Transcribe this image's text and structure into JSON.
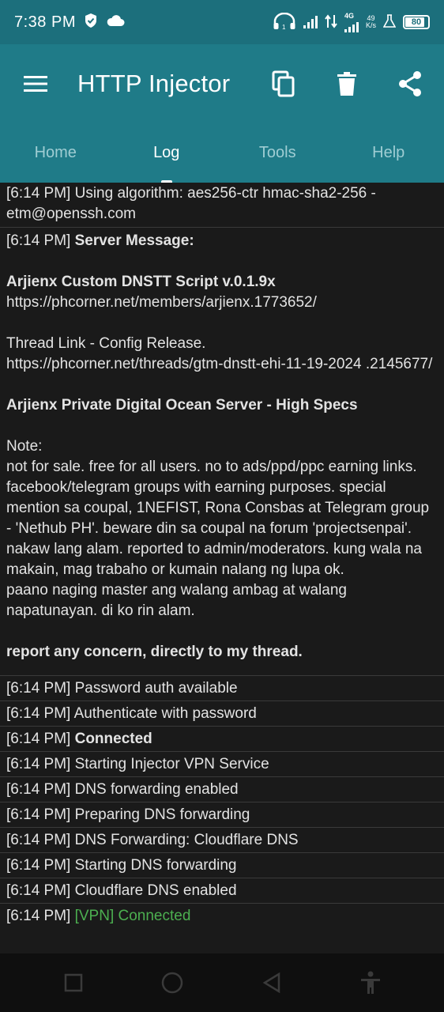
{
  "status_bar": {
    "time": "7:38 PM",
    "network_speed_value": "49",
    "network_speed_unit": "K/s",
    "network_type": "4G",
    "battery": "80"
  },
  "app": {
    "title": "HTTP Injector"
  },
  "tabs": [
    {
      "label": "Home"
    },
    {
      "label": "Log"
    },
    {
      "label": "Tools"
    },
    {
      "label": "Help"
    }
  ],
  "log": {
    "entry_1": {
      "time": "[6:14 PM]",
      "text": "Using algorithm: aes256-ctr hmac-sha2-256 -etm@openssh.com"
    },
    "server": {
      "time": "[6:14 PM]",
      "heading": "Server Message:",
      "title": "Arjienx Custom DNSTT Script v.0.1.9x",
      "profile_link": "https://phcorner.net/members/arjienx.1773652/",
      "thread_label": "Thread Link - Config Release.",
      "thread_link": "https://phcorner.net/threads/gtm-dnstt-ehi-11-19-2024 .2145677/",
      "server_title": "Arjienx Private Digital Ocean Server - High Specs",
      "note_label": "Note:",
      "note_body": "not for sale. free for all users. no to ads/ppd/ppc earning links. facebook/telegram groups with earning purposes. special mention sa coupal, 1NEFIST, Rona Consbas at Telegram group - 'Nethub PH'. beware din sa coupal na forum 'projectsenpai'. nakaw lang alam. reported to admin/moderators. kung wala na makain, mag trabaho or kumain nalang ng lupa ok.",
      "note_body_2": "paano naging master ang walang ambag at walang napatunayan. di ko rin alam.",
      "footer": "report any concern, directly to my thread."
    },
    "entries": [
      {
        "time": "[6:14 PM]",
        "text": "Password auth available"
      },
      {
        "time": "[6:14 PM]",
        "text": "Authenticate with password"
      },
      {
        "time": "[6:14 PM]",
        "text": "Connected"
      },
      {
        "time": "[6:14 PM]",
        "text": "Starting Injector VPN Service"
      },
      {
        "time": "[6:14 PM]",
        "text": "DNS forwarding enabled"
      },
      {
        "time": "[6:14 PM]",
        "text": "Preparing DNS forwarding"
      },
      {
        "time": "[6:14 PM]",
        "text": "DNS Forwarding: Cloudflare DNS"
      },
      {
        "time": "[6:14 PM]",
        "text": "Starting DNS forwarding"
      },
      {
        "time": "[6:14 PM]",
        "text": "Cloudflare DNS enabled"
      },
      {
        "time": "[6:14 PM]",
        "text": "[VPN] Connected"
      }
    ]
  },
  "colors": {
    "app_bar": "#1f7b88",
    "status_bar": "#1c6f7c",
    "background": "#1a1a1a",
    "connected_green": "#4caf50"
  },
  "icons": {
    "menu": "menu-icon",
    "copy": "copy-icon",
    "delete": "trash-icon",
    "share": "share-icon",
    "recents": "square-recents-icon",
    "home": "circle-home-icon",
    "back": "triangle-back-icon",
    "accessibility": "accessibility-icon"
  }
}
